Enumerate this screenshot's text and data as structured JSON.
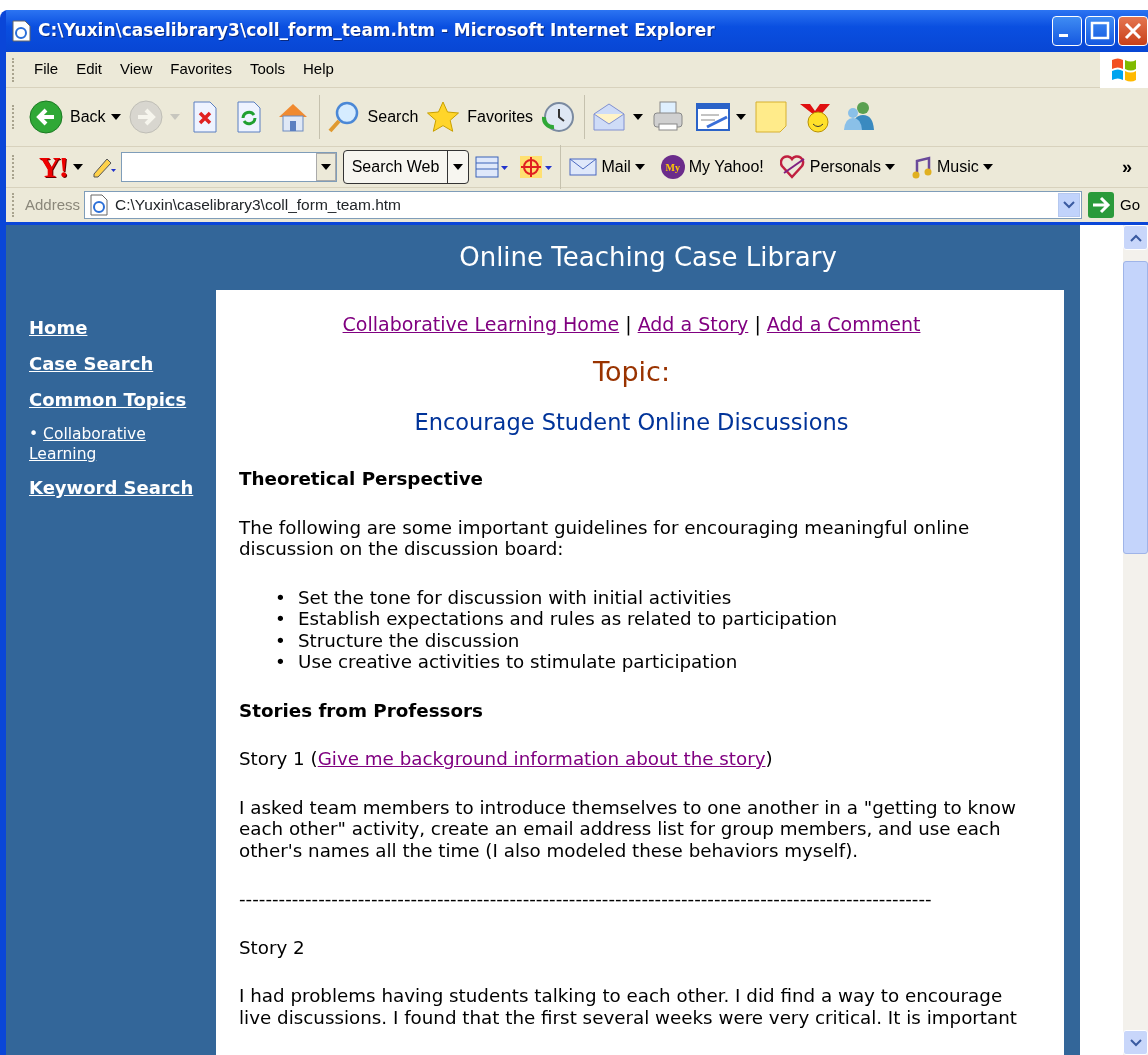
{
  "window": {
    "title": "C:\\Yuxin\\caselibrary3\\coll_form_team.htm - Microsoft Internet Explorer"
  },
  "menu": [
    "File",
    "Edit",
    "View",
    "Favorites",
    "Tools",
    "Help"
  ],
  "toolbar": [
    {
      "kind": "back",
      "label": "Back",
      "dropdown": true,
      "disabled": false
    },
    {
      "kind": "forward",
      "dropdown": true,
      "disabled": true
    },
    {
      "kind": "stop",
      "dropdown": false,
      "disabled": false
    },
    {
      "kind": "refresh",
      "dropdown": false,
      "disabled": false
    },
    {
      "kind": "home",
      "dropdown": false,
      "disabled": false
    },
    {
      "kind": "separator"
    },
    {
      "kind": "search",
      "label": "Search",
      "dropdown": false,
      "disabled": false
    },
    {
      "kind": "star",
      "label": "Favorites",
      "dropdown": false,
      "disabled": false
    },
    {
      "kind": "history",
      "dropdown": false,
      "disabled": false
    },
    {
      "kind": "separator"
    },
    {
      "kind": "mail",
      "dropdown": true,
      "disabled": false
    },
    {
      "kind": "print",
      "dropdown": false,
      "disabled": false
    },
    {
      "kind": "edit",
      "dropdown": true,
      "disabled": false
    },
    {
      "kind": "note",
      "dropdown": false,
      "disabled": false
    },
    {
      "kind": "smiley",
      "dropdown": false,
      "disabled": false
    },
    {
      "kind": "people",
      "dropdown": false,
      "disabled": false
    }
  ],
  "yahoo_bar": {
    "logo": "Y!",
    "search_button": "Search Web",
    "items": [
      {
        "kind": "envelope",
        "label": "Mail"
      },
      {
        "kind": "my",
        "badge": "My",
        "label": "My Yahoo!",
        "dropdown": false
      },
      {
        "kind": "heart",
        "label": "Personals"
      },
      {
        "kind": "music",
        "label": "Music"
      }
    ],
    "more": "»"
  },
  "address": {
    "label": "Address",
    "url": "C:\\Yuxin\\caselibrary3\\coll_form_team.htm",
    "go": "Go"
  },
  "page": {
    "header": "Online Teaching Case Library",
    "sidebar": [
      {
        "kind": "main",
        "label": "Home"
      },
      {
        "kind": "main",
        "label": "Case Search"
      },
      {
        "kind": "main",
        "label": "Common Topics"
      },
      {
        "kind": "sub",
        "bullet": "•",
        "label": "Collaborative Learning"
      },
      {
        "kind": "main",
        "label": "Keyword Search"
      }
    ],
    "nav": [
      {
        "kind": "link",
        "text": "Collaborative Learning Home"
      },
      {
        "kind": "sep",
        "text": "|"
      },
      {
        "kind": "link",
        "text": "Add a Story"
      },
      {
        "kind": "sep",
        "text": "|"
      },
      {
        "kind": "link",
        "text": "Add a Comment"
      }
    ],
    "topic_label": "Topic:",
    "topic_title": "Encourage Student Online Discussions",
    "content": [
      {
        "kind": "heading",
        "text": "Theoretical Perspective"
      },
      {
        "kind": "paragraph",
        "text": "The following are some important guidelines for encouraging meaningful online discussion on the discussion board:"
      },
      {
        "kind": "list",
        "marker": "•",
        "items": [
          "Set the tone for discussion with initial activities",
          "Establish expectations and rules as related to participation",
          "Structure the discussion",
          "Use creative activities to stimulate participation"
        ]
      },
      {
        "kind": "heading",
        "text": "Stories from Professors"
      },
      {
        "kind": "story",
        "prefix": "Story 1 (",
        "link": "Give me background information about the story",
        "suffix": ")"
      },
      {
        "kind": "paragraph",
        "text": "I asked team members to introduce themselves to one another in a \"getting to know each other\" activity, create an email address list for group members, and use each other's names all the time (I also modeled these behaviors myself)."
      },
      {
        "kind": "rule",
        "text": "---------------------------------------------------------------------------------------------------------"
      },
      {
        "kind": "paragraph",
        "text": "Story 2"
      },
      {
        "kind": "paragraph",
        "text": "I had problems having students talking to each other. I did find a way to encourage live discussions. I found that the first several weeks were very critical. It is important"
      }
    ]
  }
}
